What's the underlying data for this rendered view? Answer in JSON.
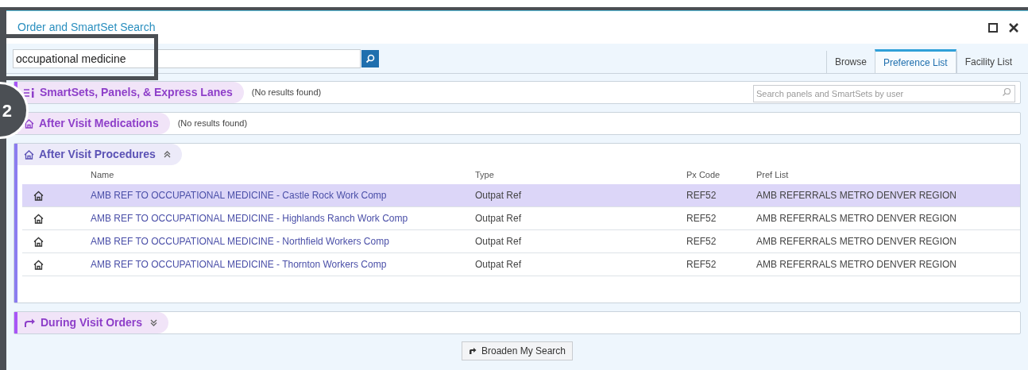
{
  "window": {
    "title": "Order and SmartSet Search"
  },
  "search": {
    "value": "occupational medicine"
  },
  "tabs": [
    {
      "label": "Browse",
      "selected": false
    },
    {
      "label": "Preference List",
      "selected": true
    },
    {
      "label": "Facility List",
      "selected": false
    }
  ],
  "user_search": {
    "placeholder": "Search panels and SmartSets by user"
  },
  "callout": {
    "label": "2"
  },
  "sections": [
    {
      "kind": "smartsets",
      "title": "SmartSets, Panels, & Express Lanes",
      "note": "(No results found)",
      "color": "#a855f7"
    },
    {
      "kind": "medications",
      "title": "After Visit Medications",
      "note": "(No results found)"
    },
    {
      "kind": "procedures",
      "title": "After Visit Procedures",
      "color": "#8b7cf0",
      "expanded": true,
      "columns": [
        "Name",
        "Type",
        "Px Code",
        "Pref List"
      ],
      "rows": [
        {
          "selected": true,
          "cells": [
            "AMB REF TO OCCUPATIONAL MEDICINE - Castle Rock Work Comp",
            "Outpat Ref",
            "REF52",
            "AMB REFERRALS METRO DENVER REGION"
          ]
        },
        {
          "selected": false,
          "cells": [
            "AMB REF TO OCCUPATIONAL MEDICINE - Highlands Ranch Work Comp",
            "Outpat Ref",
            "REF52",
            "AMB REFERRALS METRO DENVER REGION"
          ]
        },
        {
          "selected": false,
          "cells": [
            "AMB REF TO OCCUPATIONAL MEDICINE - Northfield Workers Comp",
            "Outpat Ref",
            "REF52",
            "AMB REFERRALS METRO DENVER REGION"
          ]
        },
        {
          "selected": false,
          "cells": [
            "AMB REF TO OCCUPATIONAL MEDICINE - Thornton Workers Comp",
            "Outpat Ref",
            "REF52",
            "AMB REFERRALS METRO DENVER REGION"
          ]
        }
      ]
    },
    {
      "kind": "orders",
      "title": "During Visit Orders",
      "color": "#a855f7",
      "expanded": false
    }
  ],
  "broaden_button": {
    "label": "Broaden My Search"
  }
}
